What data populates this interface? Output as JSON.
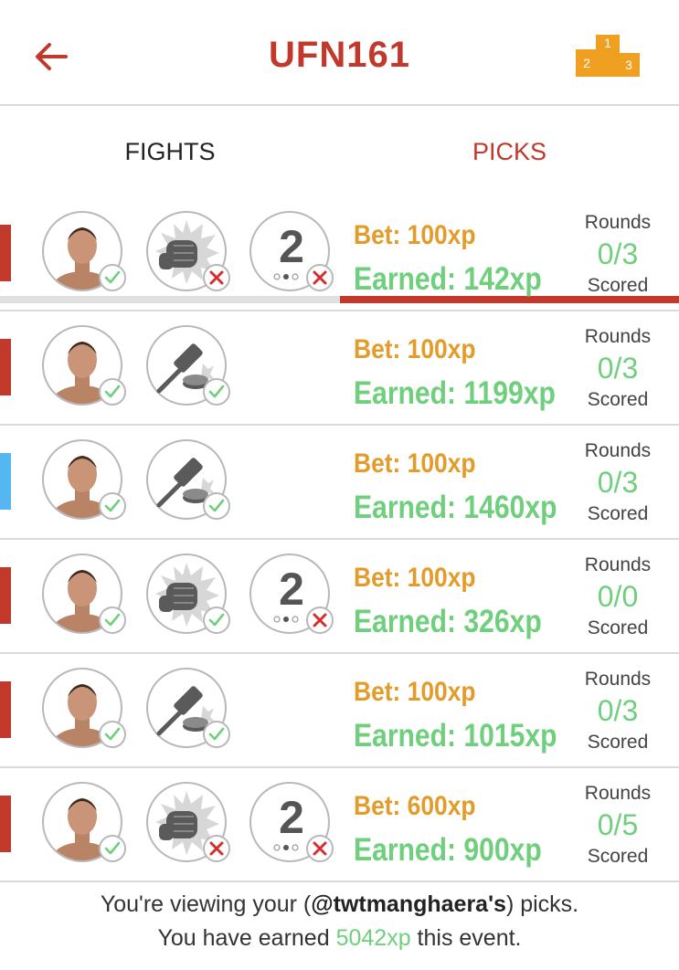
{
  "header": {
    "title": "UFN161",
    "podium_numbers": [
      "2",
      "1",
      "3"
    ]
  },
  "colors": {
    "red": "#c0392b",
    "blue": "#55b7f0",
    "orange": "#e39b2a",
    "green": "#6fcf7d"
  },
  "tabs": [
    {
      "label": "FIGHTS"
    },
    {
      "label": "PICKS",
      "active": true
    }
  ],
  "picks": [
    {
      "corner": "red",
      "fighter_status": "check",
      "method": "ko",
      "method_status": "cross",
      "round": "2",
      "round_status": "cross",
      "bet": "Bet: 100xp",
      "earned": "Earned: 142xp",
      "rounds_label": "Rounds",
      "rounds_value": "0/3",
      "scored_label": "Scored"
    },
    {
      "corner": "red",
      "fighter_status": "check",
      "method": "decision",
      "method_status": "check",
      "round": "",
      "bet": "Bet: 100xp",
      "earned": "Earned: 1199xp",
      "rounds_label": "Rounds",
      "rounds_value": "0/3",
      "scored_label": "Scored"
    },
    {
      "corner": "blue",
      "fighter_status": "check",
      "method": "decision",
      "method_status": "check",
      "round": "",
      "bet": "Bet: 100xp",
      "earned": "Earned: 1460xp",
      "rounds_label": "Rounds",
      "rounds_value": "0/3",
      "scored_label": "Scored"
    },
    {
      "corner": "red",
      "fighter_status": "check",
      "method": "ko",
      "method_status": "check",
      "round": "2",
      "round_status": "cross",
      "bet": "Bet: 100xp",
      "earned": "Earned: 326xp",
      "rounds_label": "Rounds",
      "rounds_value": "0/0",
      "scored_label": "Scored"
    },
    {
      "corner": "red",
      "fighter_status": "check",
      "method": "decision",
      "method_status": "check",
      "round": "",
      "bet": "Bet: 100xp",
      "earned": "Earned: 1015xp",
      "rounds_label": "Rounds",
      "rounds_value": "0/3",
      "scored_label": "Scored"
    },
    {
      "corner": "red",
      "fighter_status": "check",
      "method": "ko",
      "method_status": "cross",
      "round": "2",
      "round_status": "cross",
      "bet": "Bet: 600xp",
      "earned": "Earned: 900xp",
      "rounds_label": "Rounds",
      "rounds_value": "0/5",
      "scored_label": "Scored"
    }
  ],
  "footer": {
    "line1_prefix": "You're viewing your (",
    "username": "@twtmanghaera's",
    "line1_suffix": ") picks.",
    "line2_prefix": "You have earned ",
    "total_xp": "5042xp",
    "line2_suffix": " this event."
  }
}
